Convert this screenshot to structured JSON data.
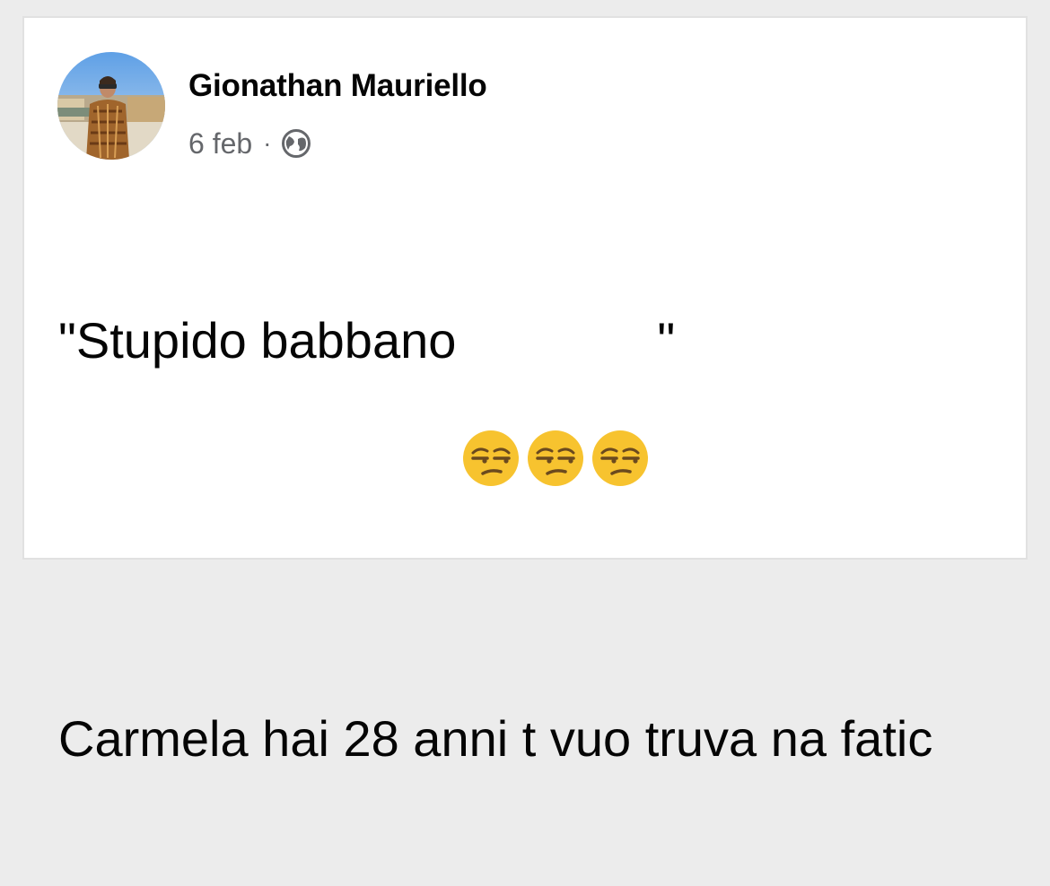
{
  "post": {
    "author_name": "Gionathan Mauriello",
    "timestamp": "6 feb",
    "separator": "·",
    "privacy_icon": "globe-icon",
    "text_line1_open": "\"Stupido babbano",
    "emoji": [
      "unamused-face",
      "unamused-face",
      "unamused-face"
    ],
    "text_line1_close": "\"",
    "text_line2": "Carmela hai 28 anni t vuo truva na fatic"
  },
  "colors": {
    "background": "#ececec",
    "card": "#ffffff",
    "text_primary": "#050505",
    "text_secondary": "#65676b",
    "emoji_face": "#f7c32f"
  }
}
